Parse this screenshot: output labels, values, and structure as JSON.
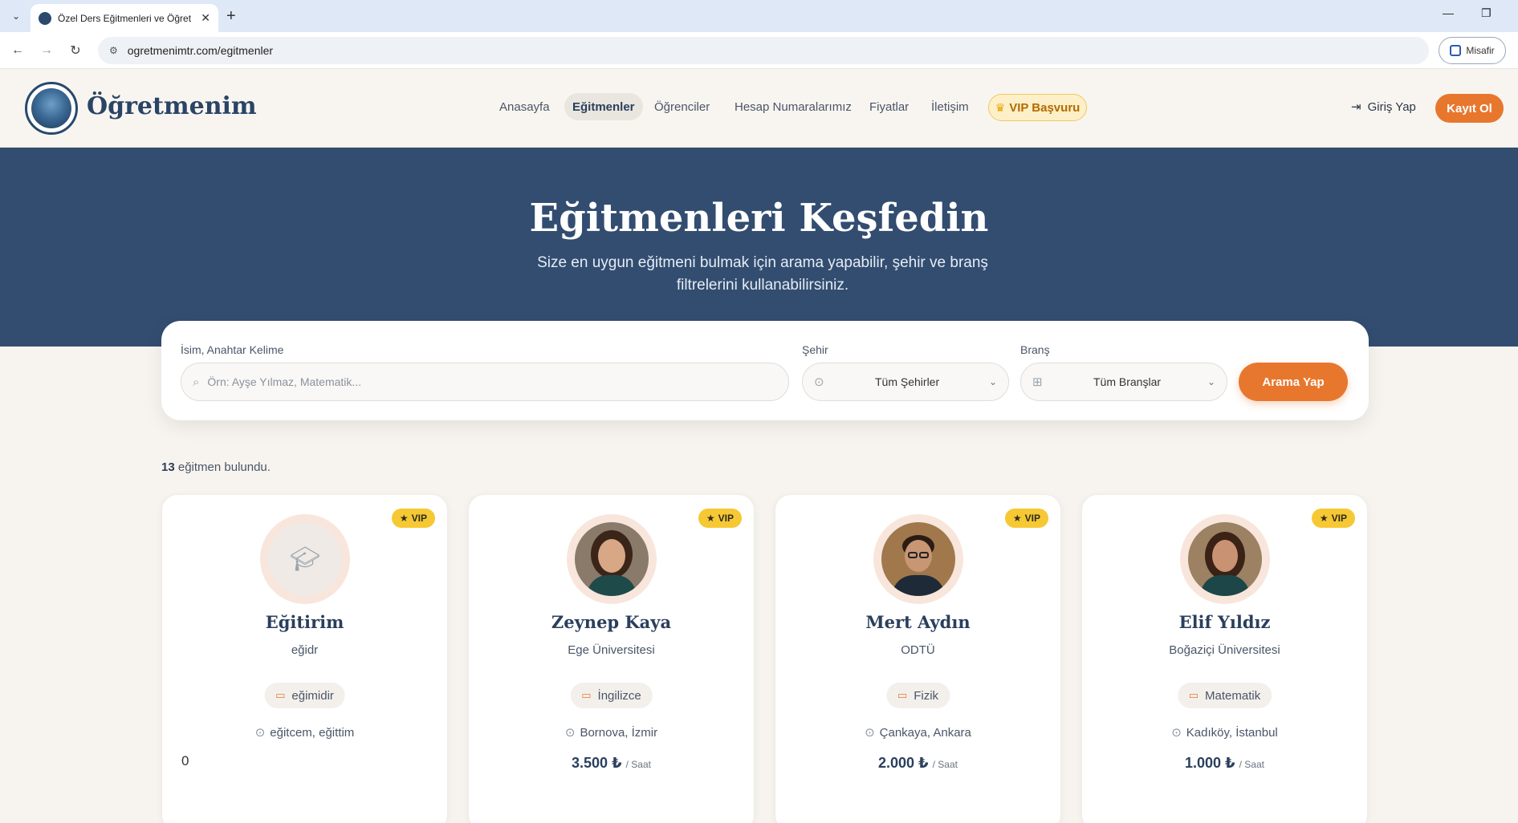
{
  "browser": {
    "tab_title": "Özel Ders Eğitmenleri ve Öğret",
    "url": "ogretmenimtr.com/egitmenler",
    "profile_label": "Misafir"
  },
  "header": {
    "brand": "Öğretmenim",
    "nav": [
      "Anasayfa",
      "Eğitmenler",
      "Öğrenciler",
      "Hesap Numaralarımız",
      "Fiyatlar",
      "İletişim"
    ],
    "vip_label": "VIP Başvuru",
    "login_label": "Giriş Yap",
    "register_label": "Kayıt Ol"
  },
  "hero": {
    "title": "Eğitmenleri Keşfedin",
    "subtitle": "Size en uygun eğitmeni bulmak için arama yapabilir, şehir ve branş filtrelerini kullanabilirsiniz."
  },
  "search": {
    "keyword_label": "İsim, Anahtar Kelime",
    "keyword_placeholder": "Örn: Ayşe Yılmaz, Matematik...",
    "city_label": "Şehir",
    "city_value": "Tüm Şehirler",
    "branch_label": "Branş",
    "branch_value": "Tüm Branşlar",
    "button": "Arama Yap"
  },
  "results": {
    "count": "13",
    "count_suffix": "eğitmen bulundu."
  },
  "cards": [
    {
      "badge": "VIP",
      "name": "Eğitirim",
      "university": "eğidr",
      "branch": "eğimidir",
      "location": "eğitcem, eğittim",
      "price": "",
      "unit": "",
      "extra": "0"
    },
    {
      "badge": "VIP",
      "name": "Zeynep Kaya",
      "university": "Ege Üniversitesi",
      "branch": "İngilizce",
      "location": "Bornova, İzmir",
      "price": "3.500 ₺",
      "unit": "/ Saat",
      "extra": ""
    },
    {
      "badge": "VIP",
      "name": "Mert Aydın",
      "university": "ODTÜ",
      "branch": "Fizik",
      "location": "Çankaya, Ankara",
      "price": "2.000 ₺",
      "unit": "/ Saat",
      "extra": ""
    },
    {
      "badge": "VIP",
      "name": "Elif Yıldız",
      "university": "Boğaziçi Üniversitesi",
      "branch": "Matematik",
      "location": "Kadıköy, İstanbul",
      "price": "1.000 ₺",
      "unit": "/ Saat",
      "extra": ""
    }
  ],
  "colors": {
    "primary": "#324d70",
    "accent": "#e8772e",
    "vip": "#f6c833"
  }
}
